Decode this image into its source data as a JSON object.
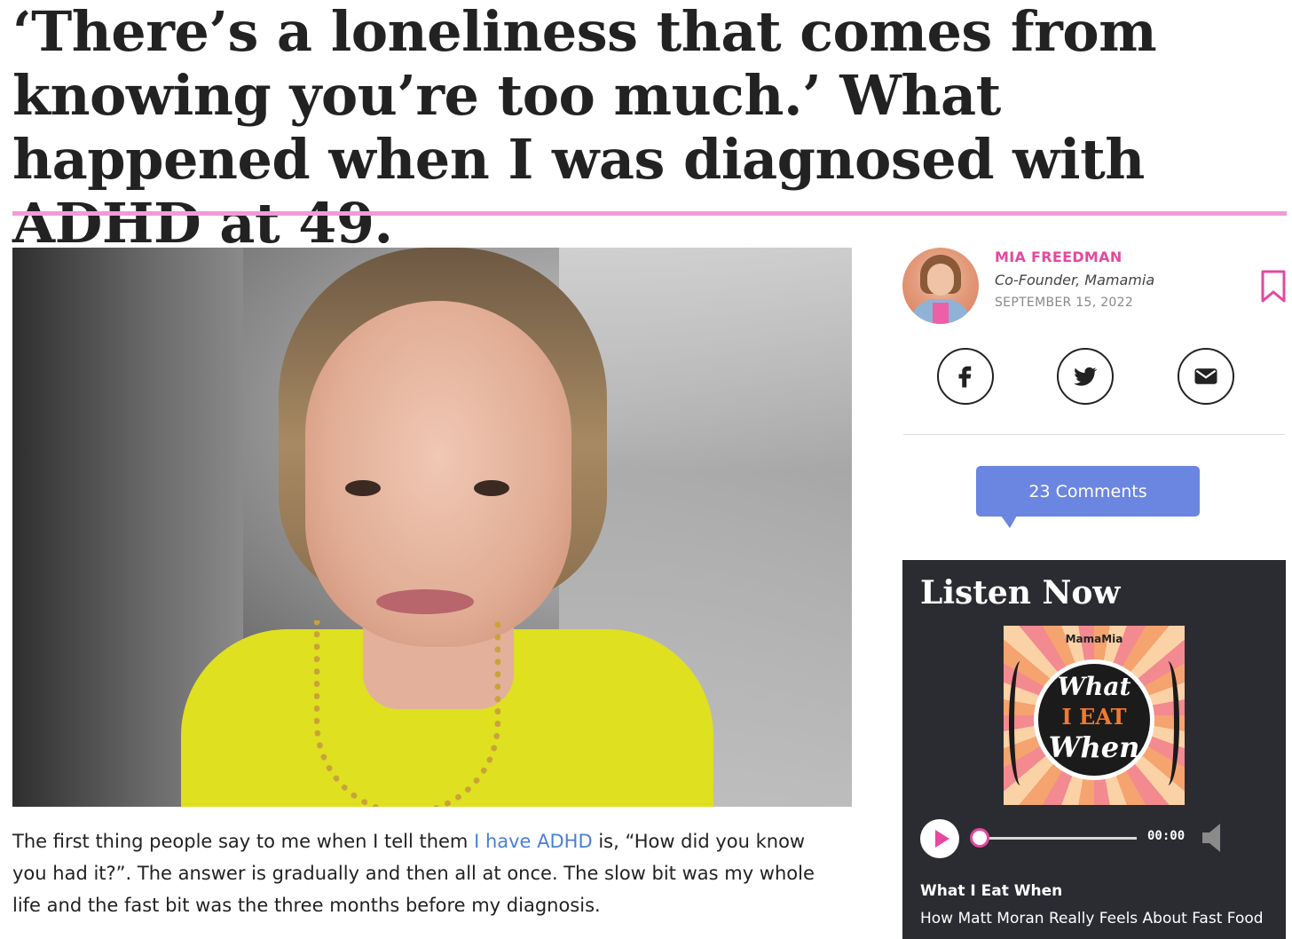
{
  "article": {
    "headline": "‘There’s a loneliness that comes from knowing you’re too much.’ What happened when I was diagnosed with ADHD at 49.",
    "body_before_link": "The first thing people say to me when I tell them ",
    "body_link": "I have ADHD",
    "body_after_link": " is, “How did you know you had it?”. The answer is gradually and then all at once. The slow bit was my whole life and the fast bit was the three months before my diagnosis."
  },
  "author": {
    "name": "MIA FREEDMAN",
    "role": "Co-Founder, Mamamia",
    "date": "SEPTEMBER 15, 2022"
  },
  "share": {
    "icons": [
      "facebook-icon",
      "twitter-icon",
      "email-icon"
    ]
  },
  "comments": {
    "label": "23 Comments"
  },
  "listen": {
    "title": "Listen Now",
    "cover_brand": "MamaMia",
    "cover_line1": "What",
    "cover_line2": "I EAT",
    "cover_line3": "When",
    "time": "00:00",
    "progress": 0,
    "show_name": "What I Eat When",
    "episode_title": "How Matt Moran Really Feels About Fast Food"
  },
  "colors": {
    "accent_pink": "#e5489f",
    "rule_pink": "#f19ad8",
    "link_blue": "#4a7fd8",
    "button_blue": "#6b86e0",
    "panel_dark": "#2b2b32"
  }
}
